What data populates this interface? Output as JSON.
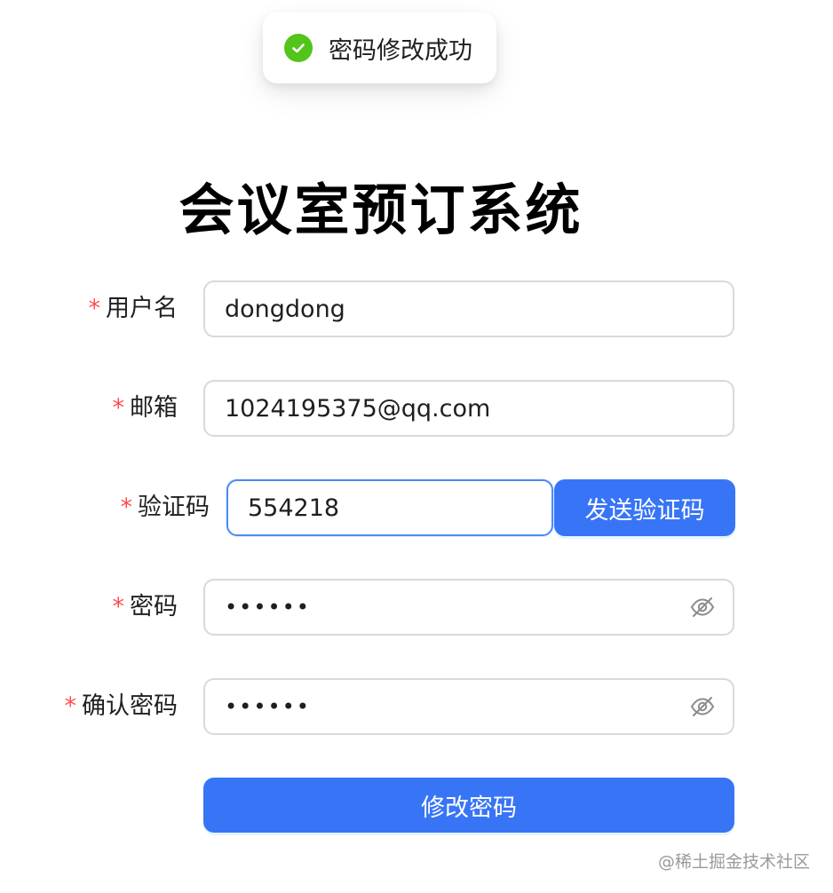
{
  "toast": {
    "icon": "check-circle-icon",
    "message": "密码修改成功",
    "color": "#52c41a"
  },
  "title": "会议室预订系统",
  "form": {
    "required_mark": "*",
    "username": {
      "label": "用户名",
      "value": "dongdong"
    },
    "email": {
      "label": "邮箱",
      "value": "1024195375@qq.com"
    },
    "captcha": {
      "label": "验证码",
      "value": "554218",
      "send_button": "发送验证码"
    },
    "password": {
      "label": "密码",
      "value": "••••••",
      "toggle_icon": "eye-invisible-icon"
    },
    "confirm_password": {
      "label": "确认密码",
      "value": "••••••",
      "toggle_icon": "eye-invisible-icon"
    },
    "submit_label": "修改密码"
  },
  "watermark": "@稀土掘金技术社区",
  "colors": {
    "primary": "#3875f6",
    "required": "#ff4d4f",
    "success": "#52c41a",
    "focus_border": "#4c8bf5"
  }
}
